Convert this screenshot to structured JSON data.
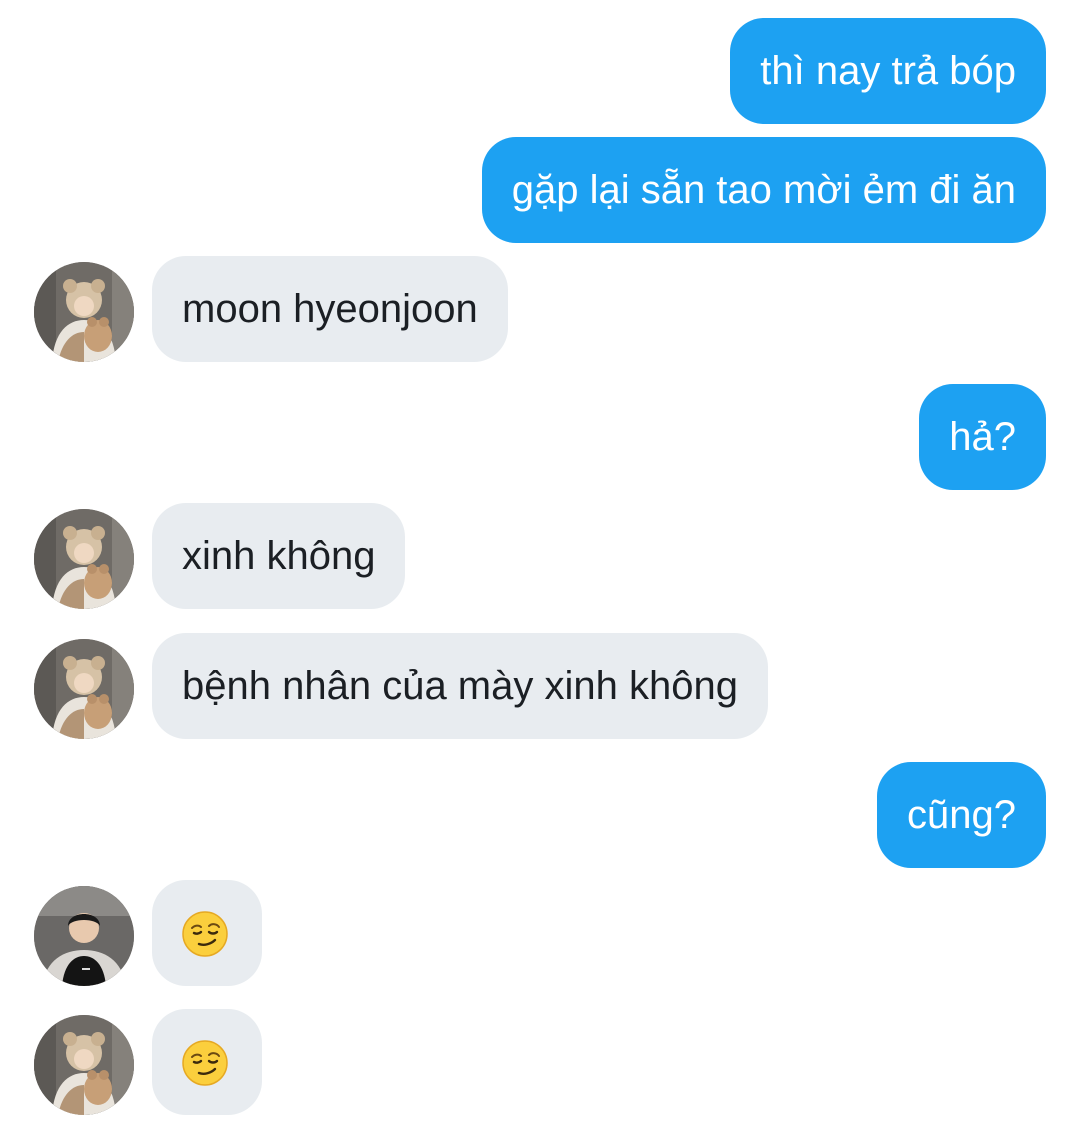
{
  "messages": [
    {
      "side": "out",
      "text": "thì nay trả bóp"
    },
    {
      "side": "out",
      "text": "gặp lại sẵn tao mời ẻm đi ăn"
    },
    {
      "side": "in",
      "avatar": "bear-hat-avatar",
      "text": "moon hyeonjoon"
    },
    {
      "side": "out",
      "text": "hả?"
    },
    {
      "side": "in",
      "avatar": "bear-hat-avatar",
      "text": "xinh không"
    },
    {
      "side": "in",
      "avatar": "bear-hat-avatar",
      "text": "bệnh nhân của mày xinh không"
    },
    {
      "side": "out",
      "text": "cũng?"
    },
    {
      "side": "in",
      "avatar": "black-shirt-avatar",
      "emoji": "smirking-face"
    },
    {
      "side": "in",
      "avatar": "bear-hat-avatar",
      "emoji": "smirking-face"
    }
  ],
  "colors": {
    "outgoing_bubble": "#1da1f2",
    "incoming_bubble": "#e8ecf0",
    "incoming_text": "#1b1f24",
    "outgoing_text": "#ffffff",
    "background": "#ffffff"
  }
}
